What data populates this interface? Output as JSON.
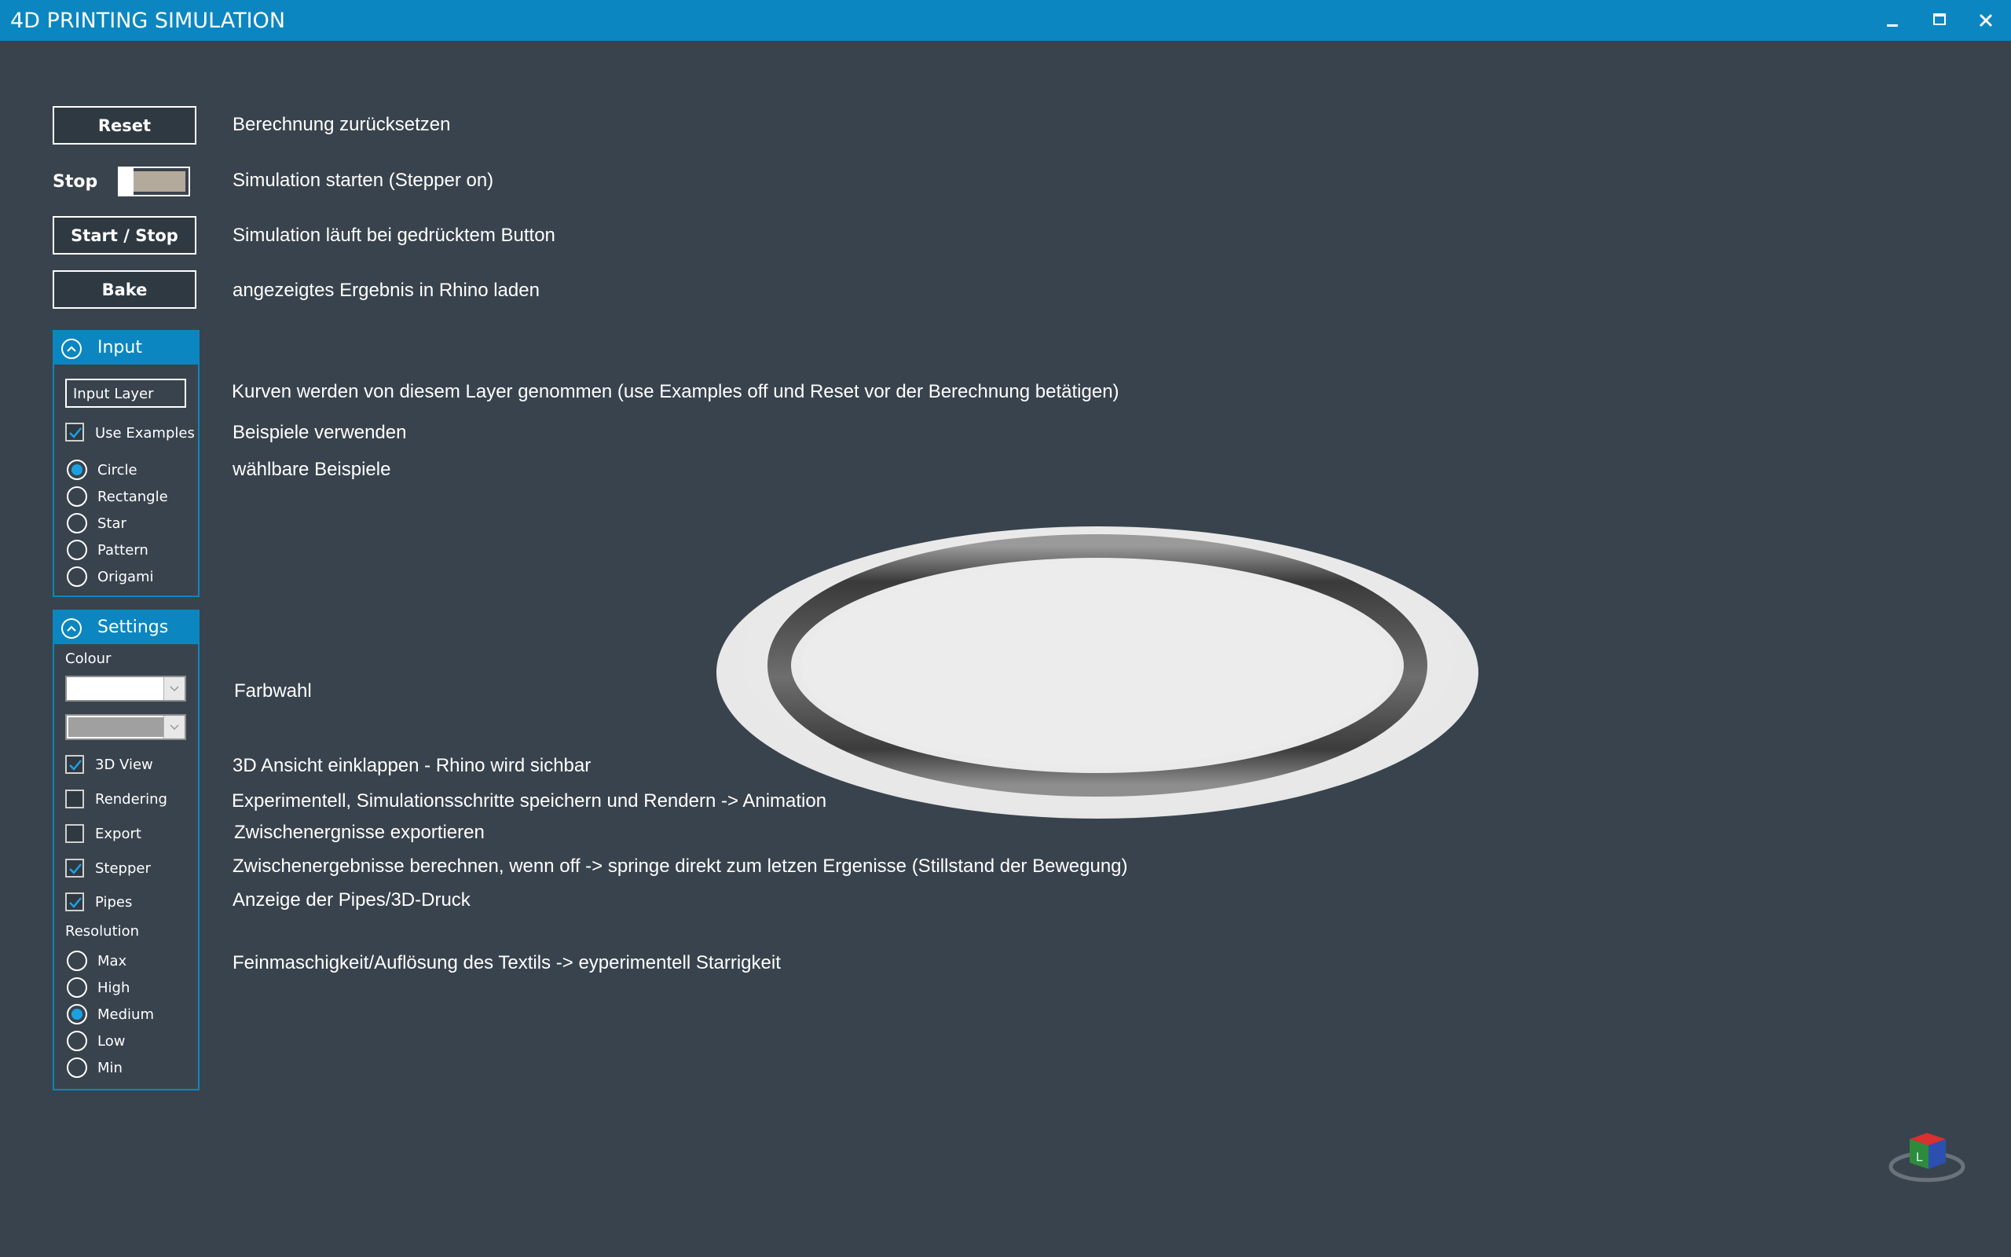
{
  "window": {
    "title": "4D PRINTING SIMULATION",
    "minimize_icon": "minimize-icon",
    "maximize_icon": "maximize-icon",
    "close_icon": "close-icon"
  },
  "controls": {
    "reset_label": "Reset",
    "stop_label": "Stop",
    "start_stop_label": "Start / Stop",
    "bake_label": "Bake"
  },
  "input_panel": {
    "title": "Input",
    "input_layer_value": "Input Layer",
    "use_examples_label": "Use Examples",
    "use_examples_checked": true,
    "examples": [
      {
        "label": "Circle",
        "selected": true
      },
      {
        "label": "Rectangle",
        "selected": false
      },
      {
        "label": "Star",
        "selected": false
      },
      {
        "label": "Pattern",
        "selected": false
      },
      {
        "label": "Origami",
        "selected": false
      }
    ]
  },
  "settings_panel": {
    "title": "Settings",
    "colour_label": "Colour",
    "colour_primary": "#ffffff",
    "colour_secondary": "#a0a0a0",
    "options": [
      {
        "label": "3D View",
        "checked": true
      },
      {
        "label": "Rendering",
        "checked": false
      },
      {
        "label": "Export",
        "checked": false
      },
      {
        "label": "Stepper",
        "checked": true
      },
      {
        "label": "Pipes",
        "checked": true
      }
    ],
    "resolution_label": "Resolution",
    "resolutions": [
      {
        "label": "Max",
        "selected": false
      },
      {
        "label": "High",
        "selected": false
      },
      {
        "label": "Medium",
        "selected": true
      },
      {
        "label": "Low",
        "selected": false
      },
      {
        "label": "Min",
        "selected": false
      }
    ]
  },
  "descriptions": {
    "reset": "Berechnung  zurücksetzen",
    "toggle": "Simulation starten (Stepper on)",
    "start_stop": "Simulation läuft bei gedrücktem Button",
    "bake": "angezeigtes Ergebnis in Rhino laden",
    "input_layer": "Kurven werden von diesem Layer genommen (use Examples off und Reset vor der Berechnung betätigen)",
    "use_examples": "Beispiele verwenden",
    "examples": "wählbare Beispiele",
    "colour": "Farbwahl",
    "view3d": "3D Ansicht einklappen - Rhino wird sichbar",
    "rendering": "Experimentell, Simulationsschritte speichern und Rendern -> Animation",
    "export": "Zwischenergnisse exportieren",
    "stepper": "Zwischenergebnisse berechnen, wenn off -> springe direkt zum letzen Ergenisse (Stillstand der Bewegung)",
    "pipes": "Anzeige der Pipes/3D-Druck",
    "resolution": "Feinmaschigkeit/Auflösung des Textils -> eyperimentell Starrigkeit"
  },
  "colors": {
    "titlebar": "#0b86c0",
    "background": "#39434d",
    "accent": "#1ba1e2"
  }
}
